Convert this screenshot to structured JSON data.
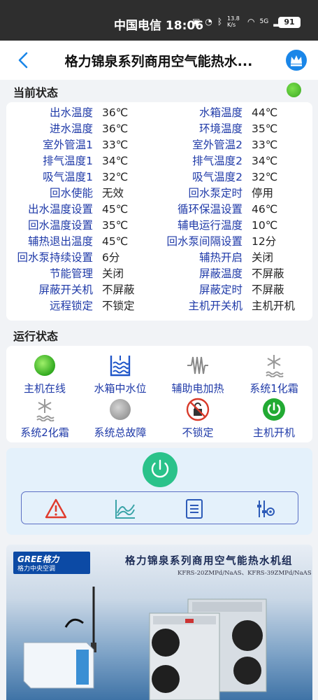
{
  "status_bar": {
    "carrier_time": "中国电信 18:06",
    "net_speed": "13.8 K/s",
    "signal": "5G",
    "battery": "91"
  },
  "header": {
    "title": "格力锦泉系列商用空气能热水..."
  },
  "current_status": {
    "title": "当前状态",
    "indicator_color": "#4cbb33",
    "rows": [
      {
        "l1": "出水温度",
        "v1": "36℃",
        "l2": "水箱温度",
        "v2": "44℃"
      },
      {
        "l1": "进水温度",
        "v1": "36℃",
        "l2": "环境温度",
        "v2": "35℃"
      },
      {
        "l1": "室外管温1",
        "v1": "33℃",
        "l2": "室外管温2",
        "v2": "33℃"
      },
      {
        "l1": "排气温度1",
        "v1": "34℃",
        "l2": "排气温度2",
        "v2": "34℃"
      },
      {
        "l1": "吸气温度1",
        "v1": "32℃",
        "l2": "吸气温度2",
        "v2": "32℃"
      },
      {
        "l1": "回水使能",
        "v1": "无效",
        "l2": "回水泵定时",
        "v2": "停用"
      },
      {
        "l1": "出水温度设置",
        "v1": "45℃",
        "l2": "循环保温设置",
        "v2": "46℃"
      },
      {
        "l1": "回水温度设置",
        "v1": "35℃",
        "l2": "辅电运行温度",
        "v2": "10℃"
      },
      {
        "l1": "辅热退出温度",
        "v1": "45℃",
        "l2": "回水泵间隔设置",
        "v2": "12分"
      },
      {
        "l1": "回水泵持续设置",
        "v1": "6分",
        "l2": "辅热开启",
        "v2": "关闭"
      },
      {
        "l1": "节能管理",
        "v1": "关闭",
        "l2": "屏蔽温度",
        "v2": "不屏蔽"
      },
      {
        "l1": "屏蔽开关机",
        "v1": "不屏蔽",
        "l2": "屏蔽定时",
        "v2": "不屏蔽"
      },
      {
        "l1": "远程锁定",
        "v1": "不锁定",
        "l2": "主机开关机",
        "v2": "主机开机"
      }
    ]
  },
  "run_status": {
    "title": "运行状态",
    "items": [
      {
        "label": "主机在线",
        "icon": "green-circle-icon",
        "color": "#3db52a"
      },
      {
        "label": "水箱中水位",
        "icon": "water-tank-icon",
        "color": "#1f55c8"
      },
      {
        "label": "辅助电加热",
        "icon": "heater-coil-icon",
        "color": "#777777"
      },
      {
        "label": "系统1化霜",
        "icon": "snowflake-defrost-icon",
        "color": "#888888"
      },
      {
        "label": "系统2化霜",
        "icon": "snowflake-defrost-icon",
        "color": "#888888"
      },
      {
        "label": "系统总故障",
        "icon": "grey-circle-icon",
        "color": "#a8a8a8"
      },
      {
        "label": "不锁定",
        "icon": "unlocked-icon",
        "color": "#d83a2a"
      },
      {
        "label": "主机开机",
        "icon": "power-on-icon",
        "color": "#22aa33"
      }
    ]
  },
  "controls": {
    "power_color": "#2ac28a",
    "tools": [
      "alarm-icon",
      "curve-chart-icon",
      "list-icon",
      "settings-sliders-icon"
    ]
  },
  "banner": {
    "logo_main": "GREE格力",
    "logo_sub": "格力中央空调",
    "title": "格力锦泉系列商用空气能热水机组",
    "subtitle": "KFRS-20ZMPd/NaAS、KFRS-39ZMPd/NaAS"
  }
}
